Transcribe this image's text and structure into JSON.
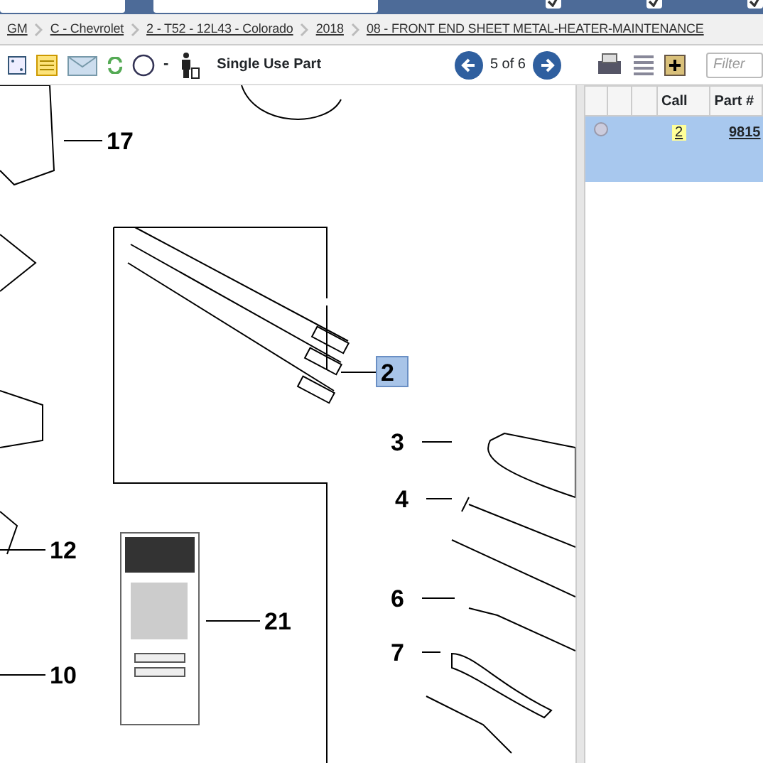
{
  "top_bar": {
    "filters": [
      {
        "checked": true
      },
      {
        "checked": true
      },
      {
        "checked": true
      }
    ]
  },
  "breadcrumbs": [
    "GM",
    "C - Chevrolet",
    "2 - T52 - 12L43 - Colorado",
    "2018",
    "08 - FRONT END SHEET METAL-HEATER-MAINTENANCE"
  ],
  "toolbar": {
    "separator": "-",
    "title": "Single Use Part",
    "page": "5 of 6"
  },
  "diagram": {
    "callouts": [
      {
        "label": "17",
        "selected": false
      },
      {
        "label": "2",
        "selected": true
      },
      {
        "label": "3",
        "selected": false
      },
      {
        "label": "4",
        "selected": false
      },
      {
        "label": "12",
        "selected": false
      },
      {
        "label": "21",
        "selected": false
      },
      {
        "label": "6",
        "selected": false
      },
      {
        "label": "7",
        "selected": false
      },
      {
        "label": "10",
        "selected": false
      }
    ]
  },
  "parts_panel": {
    "filter": {
      "placeholder": "Filter"
    },
    "columns": [
      "Call",
      "Part #"
    ],
    "rows": [
      {
        "call": "2",
        "part": "9815",
        "selected": true
      }
    ]
  }
}
